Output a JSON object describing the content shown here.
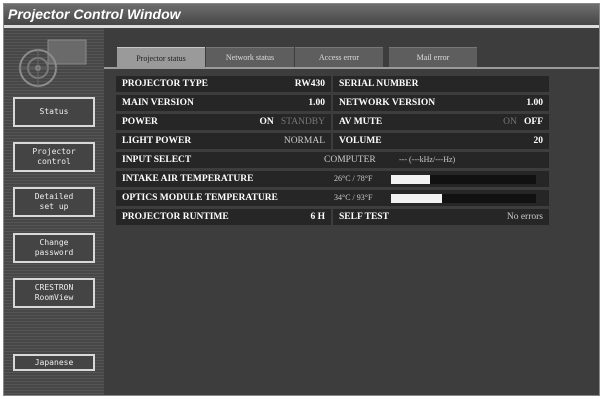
{
  "window": {
    "title": "Projector Control Window"
  },
  "sidebar": {
    "items": [
      {
        "label": "Status"
      },
      {
        "label": "Projector\ncontrol"
      },
      {
        "label": "Detailed\nset up"
      },
      {
        "label": "Change\npassword"
      },
      {
        "label": "CRESTRON\nRoomView"
      }
    ],
    "language_button": "Japanese"
  },
  "tabs": [
    {
      "label": "Projector status",
      "active": true
    },
    {
      "label": "Network status"
    },
    {
      "label": "Access error"
    },
    {
      "label": "Mail error"
    }
  ],
  "status": {
    "projector_type": {
      "label": "PROJECTOR TYPE",
      "value": "RW430"
    },
    "serial_number": {
      "label": "SERIAL NUMBER",
      "value": ""
    },
    "main_version": {
      "label": "MAIN VERSION",
      "value": "1.00"
    },
    "network_version": {
      "label": "NETWORK VERSION",
      "value": "1.00"
    },
    "power": {
      "label": "POWER",
      "on": "ON",
      "standby": "STANDBY"
    },
    "av_mute": {
      "label": "AV MUTE",
      "on": "ON",
      "off": "OFF"
    },
    "light_power": {
      "label": "LIGHT POWER",
      "value": "NORMAL"
    },
    "volume": {
      "label": "VOLUME",
      "value": "20"
    },
    "input_select": {
      "label": "INPUT SELECT",
      "value": "COMPUTER",
      "signal": "--- (---kHz/---Hz)"
    },
    "intake_air_temperature": {
      "label": "INTAKE AIR TEMPERATURE",
      "value": "26°C / 78°F",
      "level": 0.27
    },
    "optics_module_temperature": {
      "label": "OPTICS MODULE TEMPERATURE",
      "value": "34°C / 93°F",
      "level": 0.35
    },
    "projector_runtime": {
      "label": "PROJECTOR RUNTIME",
      "value": "6 H"
    },
    "self_test": {
      "label": "SELF TEST",
      "value": "No errors"
    }
  },
  "colors": {
    "accent_bar": "#f2f2f2",
    "background": "#3d3d3d",
    "cell": "#262626"
  }
}
